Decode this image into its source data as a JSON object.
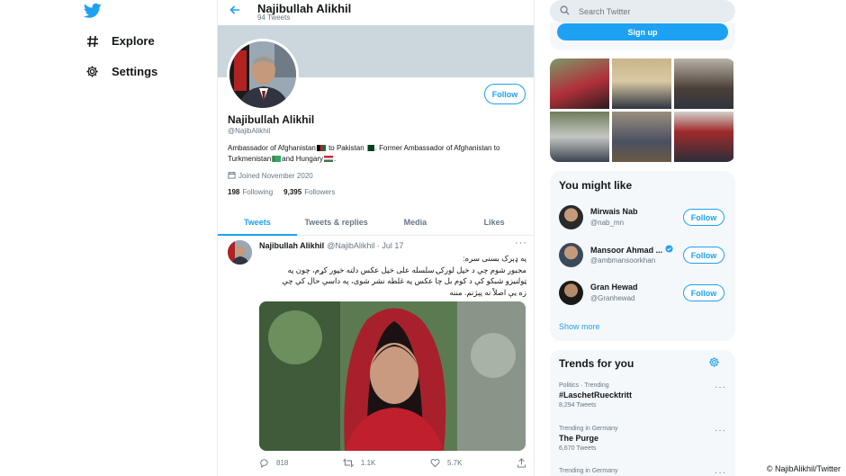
{
  "nav": {
    "logo_icon": "twitter-bird-icon",
    "items": [
      {
        "label": "Explore",
        "icon": "hashtag-icon"
      },
      {
        "label": "Settings",
        "icon": "gear-icon"
      }
    ]
  },
  "header": {
    "name": "Najibullah Alikhil",
    "tweet_count": "94 Tweets"
  },
  "profile": {
    "follow_label": "Follow",
    "name": "Najibullah Alikhil",
    "handle": "@NajibAlikhil",
    "bio_1": "Ambassador of Afghanistan",
    "bio_2": " to Pakistan",
    "bio_3": ". Former Ambassador of Afghanistan to Turkmenistan",
    "bio_4": "and Hungary",
    "bio_5": ".",
    "joined": "Joined November 2020",
    "following_count": "198",
    "following_label": "Following",
    "followers_count": "9,395",
    "followers_label": "Followers"
  },
  "tabs": [
    {
      "label": "Tweets",
      "active": true
    },
    {
      "label": "Tweets & replies"
    },
    {
      "label": "Media"
    },
    {
      "label": "Likes"
    }
  ],
  "tweet": {
    "author": "Najibullah Alikhil",
    "handle_date": "@NajibAlikhil · Jul 17",
    "more": "···",
    "text_1": "په ډېرک بسنی سره:",
    "text_2": "مجبور شوم چې د خپل لورکۍ سلسله على خپل عکس دلته خپور کړم، چون په",
    "text_3": "ټولنیزو شبکو کې د کوم بل چا عکس په غلطه نشر شوی، په داسې حال کې چې",
    "text_4": "زه یې اصلاً نه پېژنم. مننه",
    "replies": "818",
    "retweets": "1.1K",
    "likes": "5.7K"
  },
  "sidebar": {
    "search_placeholder": "Search Twitter",
    "signup_label": "Sign up",
    "wtf_title": "You might like",
    "wtf": [
      {
        "name": "Mirwais Nab",
        "handle": "@nab_mn",
        "verified": false,
        "follow": "Follow"
      },
      {
        "name": "Mansoor Ahmad ...",
        "handle": "@ambmansoorkhan",
        "verified": true,
        "follow": "Follow"
      },
      {
        "name": "Gran Hewad",
        "handle": "@Granhewad",
        "verified": false,
        "follow": "Follow"
      }
    ],
    "show_more": "Show more",
    "trends_title": "Trends for you",
    "trends": [
      {
        "category": "Politics · Trending",
        "name": "#LaschetRuecktritt",
        "count": "8,294 Tweets"
      },
      {
        "category": "Trending in Germany",
        "name": "The Purge",
        "count": "6,670 Tweets"
      },
      {
        "category": "Trending in Germany",
        "name": "",
        "count": ""
      }
    ]
  },
  "credit": "© NajibAlikhil/Twitter",
  "colors": {
    "accent": "#1da1f2",
    "muted": "#657786",
    "panel": "#f5f8fa"
  }
}
